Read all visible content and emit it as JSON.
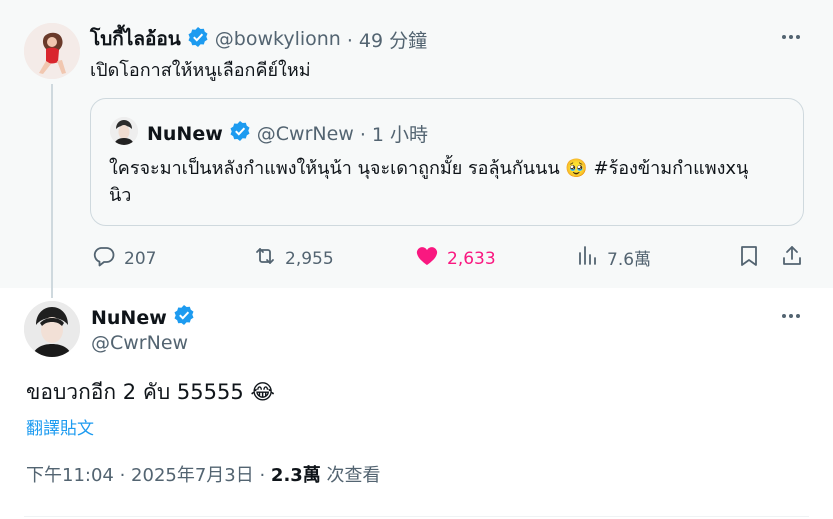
{
  "parent_tweet": {
    "display_name": "โบกี้ไลอ้อน",
    "handle": "@bowkylionn",
    "time": "· 49 分鐘",
    "text": "เปิดโอกาสให้หนูเลือกคีย์ใหม่"
  },
  "quoted_tweet": {
    "display_name": "NuNew",
    "handle": "@CwrNew",
    "time": "· 1 小時",
    "text_line1": "ใครจะมาเป็นหลังกำแพงให้นุน้า นุจะเดาถูกมั้ย รอลุ้นกันนน 🥹 #ร้องข้ามกำแพงxนุ",
    "text_line2": "นิว"
  },
  "actions": {
    "replies": "207",
    "reposts": "2,955",
    "likes": "2,633",
    "views": "7.6萬"
  },
  "main_tweet": {
    "display_name": "NuNew",
    "handle": "@CwrNew",
    "text": "ขอบวกอีก 2 คับ 55555 😂",
    "translate_label": "翻譯貼文",
    "timestamp": "下午11:04 · 2025年7月3日 · ",
    "views_count": "2.3萬",
    "views_label": " 次查看"
  },
  "colors": {
    "accent": "#1d9bf0",
    "like": "#f91880",
    "muted": "#536471",
    "parent_bg": "#f7f9f9"
  },
  "icons": [
    "verified-badge-icon",
    "more-icon",
    "reply-icon",
    "repost-icon",
    "like-heart-icon",
    "views-icon",
    "bookmark-icon",
    "share-icon"
  ]
}
